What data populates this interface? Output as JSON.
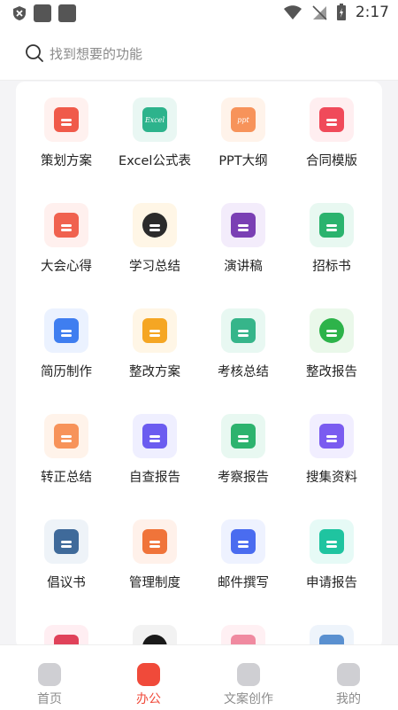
{
  "status": {
    "time": "2:17"
  },
  "search": {
    "placeholder": "找到想要的功能"
  },
  "colors": {
    "accent": "#f04a3a"
  },
  "grid": [
    {
      "label": "策划方案",
      "icon": "bookmark-doc-icon",
      "bg": "#fff1ef",
      "fg": "#f05a4a"
    },
    {
      "label": "Excel公式表",
      "icon": "excel-doc-icon",
      "bg": "#e9f7f3",
      "fg": "#2db38c",
      "text": "Excel"
    },
    {
      "label": "PPT大纲",
      "icon": "ppt-doc-icon",
      "bg": "#fff3ea",
      "fg": "#f7935a",
      "text": "ppt"
    },
    {
      "label": "合同模版",
      "icon": "contract-doc-icon",
      "bg": "#ffeef0",
      "fg": "#f04a5a"
    },
    {
      "label": "大会心得",
      "icon": "heart-doc-icon",
      "bg": "#fff0ee",
      "fg": "#f0624f"
    },
    {
      "label": "学习总结",
      "icon": "book-icon",
      "bg": "#fff6e6",
      "fg": "#2b2b2b"
    },
    {
      "label": "演讲稿",
      "icon": "speech-doc-icon",
      "bg": "#f3ecfb",
      "fg": "#7a3fb4"
    },
    {
      "label": "招标书",
      "icon": "gavel-icon",
      "bg": "#e8f8f1",
      "fg": "#2bb36e"
    },
    {
      "label": "简历制作",
      "icon": "resume-icon",
      "bg": "#ebf2ff",
      "fg": "#3f7ef0"
    },
    {
      "label": "整改方案",
      "icon": "person-doc-icon",
      "bg": "#fff6e6",
      "fg": "#f5a623"
    },
    {
      "label": "考核总结",
      "icon": "edit-doc-icon",
      "bg": "#e8f8f2",
      "fg": "#36b58a"
    },
    {
      "label": "整改报告",
      "icon": "pen-circle-icon",
      "bg": "#eaf8ea",
      "fg": "#2db34a"
    },
    {
      "label": "转正总结",
      "icon": "person-up-icon",
      "bg": "#fff3ea",
      "fg": "#f7935a"
    },
    {
      "label": "自查报告",
      "icon": "report-gear-icon",
      "bg": "#efefff",
      "fg": "#6b5cf0"
    },
    {
      "label": "考察报告",
      "icon": "magnify-doc-icon",
      "bg": "#e8f8f1",
      "fg": "#2db36e"
    },
    {
      "label": "搜集资料",
      "icon": "search-doc-icon",
      "bg": "#f1eeff",
      "fg": "#7a5cf0"
    },
    {
      "label": "倡议书",
      "icon": "check-doc-icon",
      "bg": "#eef3f8",
      "fg": "#3f6a9a"
    },
    {
      "label": "管理制度",
      "icon": "open-book-icon",
      "bg": "#fff1ea",
      "fg": "#f0743a"
    },
    {
      "label": "邮件撰写",
      "icon": "mail-icon",
      "bg": "#eef2ff",
      "fg": "#4a6cf0"
    },
    {
      "label": "申请报告",
      "icon": "apply-doc-icon",
      "bg": "#e6faf6",
      "fg": "#1fc4a0"
    },
    {
      "label": "",
      "icon": "partial-red-icon",
      "bg": "#ffeef2",
      "fg": "#e0425a"
    },
    {
      "label": "",
      "icon": "partial-black-icon",
      "bg": "#f2f2f2",
      "fg": "#1a1a1a"
    },
    {
      "label": "",
      "icon": "partial-pink-icon",
      "bg": "#fff0f3",
      "fg": "#f08aa0"
    },
    {
      "label": "",
      "icon": "partial-blue-icon",
      "bg": "#eef4fb",
      "fg": "#5a90d0"
    }
  ],
  "tabs": [
    {
      "label": "首页",
      "icon": "home-icon",
      "active": false
    },
    {
      "label": "办公",
      "icon": "office-icon",
      "active": true
    },
    {
      "label": "文案创作",
      "icon": "create-icon",
      "active": false
    },
    {
      "label": "我的",
      "icon": "profile-icon",
      "active": false
    }
  ]
}
